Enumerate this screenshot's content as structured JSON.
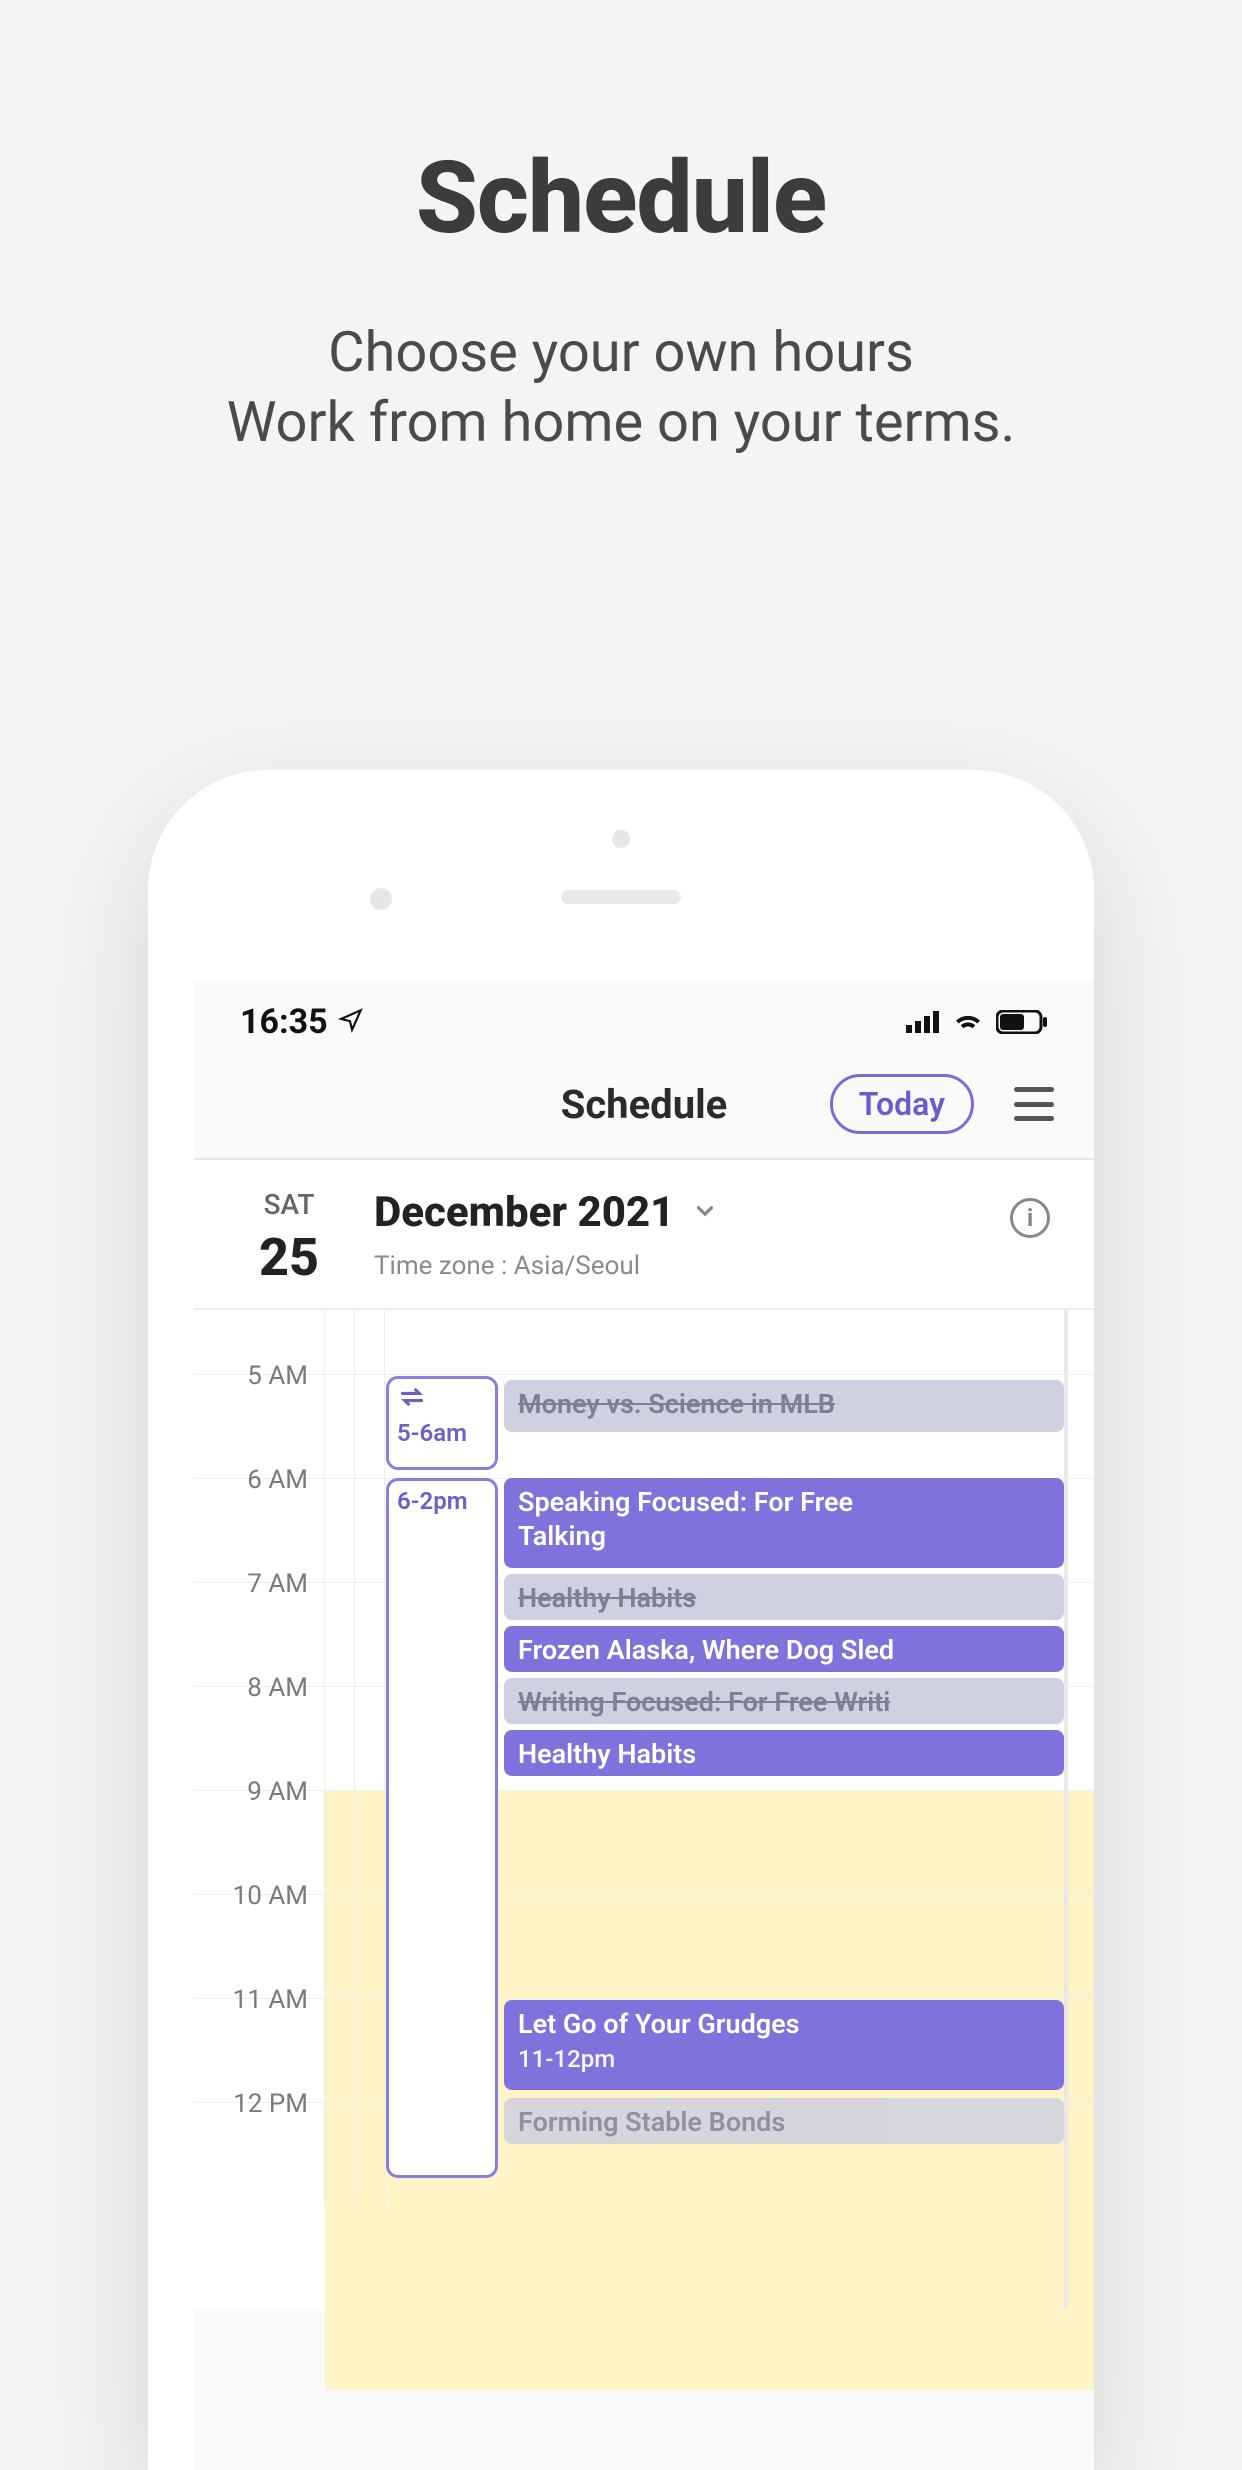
{
  "promo": {
    "title": "Schedule",
    "sub_line1": "Choose your own hours",
    "sub_line2": "Work from home on your terms."
  },
  "statusbar": {
    "time": "16:35"
  },
  "navbar": {
    "title": "Schedule",
    "today": "Today"
  },
  "date": {
    "dow": "SAT",
    "day": "25",
    "month": "December 2021",
    "timezone": "Time zone : Asia/Seoul"
  },
  "hours": [
    "5 AM",
    "6 AM",
    "7 AM",
    "8 AM",
    "9 AM",
    "10 AM",
    "11 AM",
    "12 PM"
  ],
  "side": {
    "block1_time": "5-6am",
    "block2_time": "6-2pm"
  },
  "events": {
    "e1": "Money vs. Science in MLB",
    "e2a": "Speaking Focused: For Free",
    "e2b": "Talking",
    "e3": "Healthy Habits",
    "e4": "Frozen Alaska, Where Dog Sled",
    "e5": "Writing Focused: For Free Writi",
    "e6": "Healthy Habits",
    "e7a": "Let Go of Your Grudges",
    "e7b": "11-12pm",
    "e8": "Forming Stable Bonds"
  },
  "colors": {
    "accent": "#7f72dc",
    "busy": "#fff4c6"
  }
}
